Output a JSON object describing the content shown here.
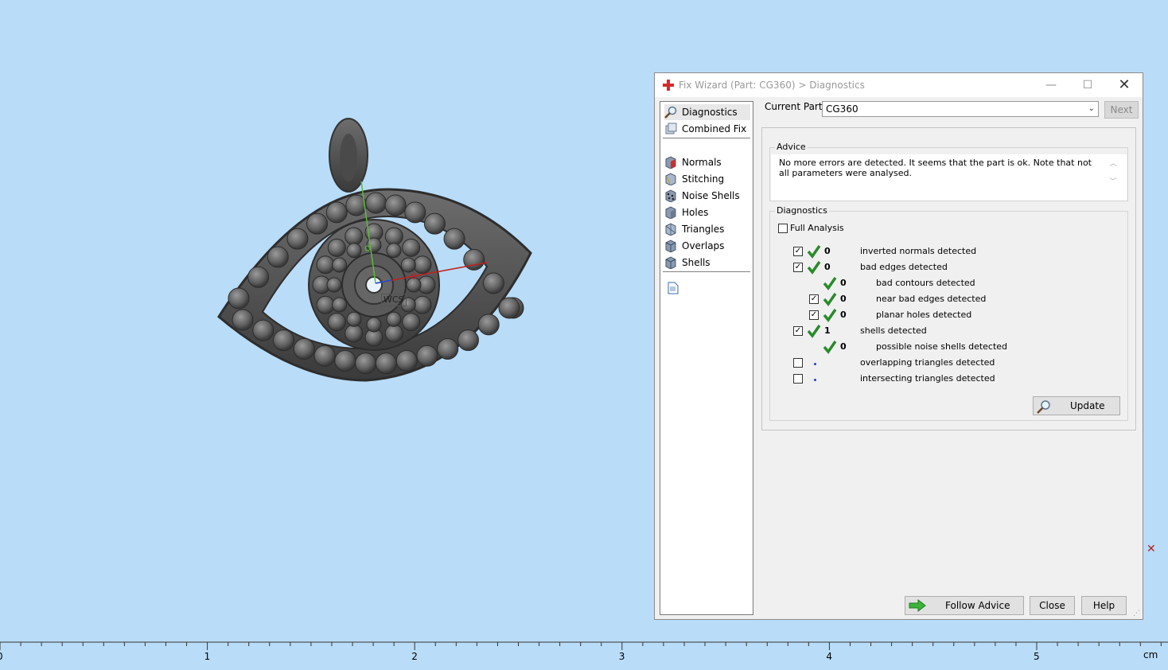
{
  "dialog": {
    "title": "Fix Wizard (Part: CG360) > Diagnostics",
    "min_icon": "minimize-icon",
    "max_icon": "maximize-icon",
    "close_icon": "close-icon"
  },
  "nav": {
    "items": [
      {
        "label": "Diagnostics",
        "icon": "magnifier-icon"
      },
      {
        "label": "Combined Fix",
        "icon": "combined-fix-icon"
      },
      {
        "label": "Normals",
        "icon": "normals-icon"
      },
      {
        "label": "Stitching",
        "icon": "stitching-icon"
      },
      {
        "label": "Noise Shells",
        "icon": "noise-shells-icon"
      },
      {
        "label": "Holes",
        "icon": "holes-icon"
      },
      {
        "label": "Triangles",
        "icon": "triangles-icon"
      },
      {
        "label": "Overlaps",
        "icon": "overlaps-icon"
      },
      {
        "label": "Shells",
        "icon": "shells-icon"
      }
    ],
    "report_icon": "report-icon"
  },
  "current_part": {
    "label": "Current Part:",
    "value": "CG360",
    "next_label": "Next"
  },
  "advice": {
    "title": "Advice",
    "text": "No more errors are detected. It seems that the part is ok. Note that not all parameters were analysed."
  },
  "diagnostics": {
    "title": "Diagnostics",
    "full_analysis_label": "Full Analysis",
    "rows": [
      {
        "count": "0",
        "label": "inverted normals detected"
      },
      {
        "count": "0",
        "label": "bad edges detected"
      },
      {
        "count": "0",
        "label": "bad contours detected"
      },
      {
        "count": "0",
        "label": "near bad edges detected"
      },
      {
        "count": "0",
        "label": "planar holes detected"
      },
      {
        "count": "1",
        "label": "shells detected"
      },
      {
        "count": "0",
        "label": "possible noise shells detected"
      },
      {
        "count": "",
        "label": "overlapping triangles detected"
      },
      {
        "count": "",
        "label": "intersecting triangles detected"
      }
    ],
    "update_label": "Update"
  },
  "footer": {
    "follow_label": "Follow Advice",
    "close_label": "Close",
    "help_label": "Help"
  },
  "viewport": {
    "wcs_label": "WCS",
    "ruler_labels": [
      "0",
      "1",
      "2",
      "3",
      "4",
      "5"
    ],
    "ruler_unit": "cm",
    "background_color": "#b9dcf8"
  }
}
